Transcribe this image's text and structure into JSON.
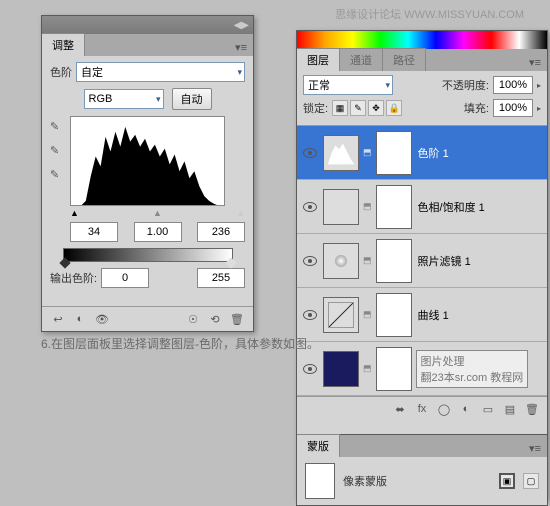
{
  "watermark": "思缘设计论坛  WWW.MISSYUAN.COM",
  "caption": "6.在图层面板里选择调整图层-色阶，具体参数如图。",
  "adjustments": {
    "tab": "调整",
    "type_label": "色阶",
    "preset": "自定",
    "channel": "RGB",
    "auto_btn": "自动",
    "input_black": "34",
    "input_gamma": "1.00",
    "input_white": "236",
    "output_label": "输出色阶:",
    "output_black": "0",
    "output_white": "255"
  },
  "layers": {
    "tabs": [
      "图层",
      "通道",
      "路径"
    ],
    "blend_mode": "正常",
    "opacity_label": "不透明度:",
    "opacity": "100%",
    "lock_label": "锁定:",
    "fill_label": "填充:",
    "fill": "100%",
    "items": [
      {
        "name": "色阶 1"
      },
      {
        "name": "色相/饱和度 1"
      },
      {
        "name": "照片滤镜 1"
      },
      {
        "name": "曲线 1"
      },
      {
        "name": "图片处理",
        "sub": "翻23本sr.com 教程网"
      }
    ]
  },
  "masks": {
    "tab": "蒙版",
    "label": "像素蒙版"
  }
}
